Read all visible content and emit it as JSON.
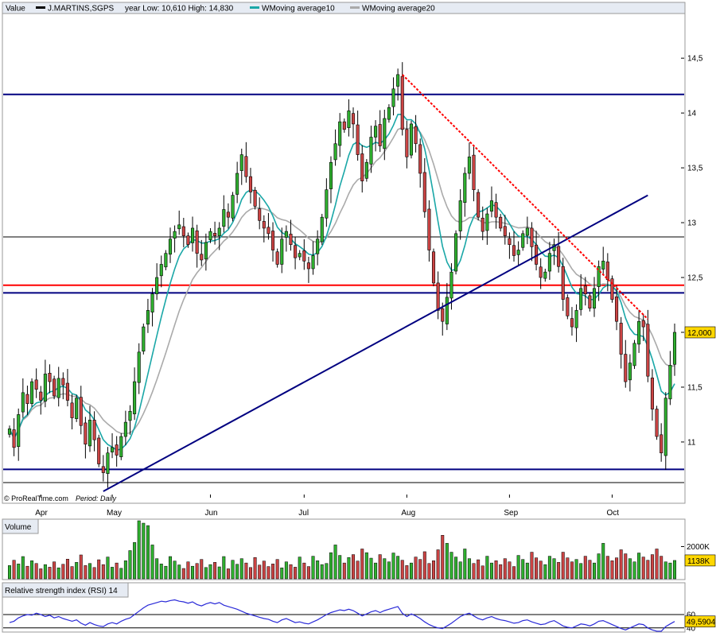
{
  "chart_data": [
    {
      "type": "candlestick",
      "header": {
        "label": "Value",
        "symbol": "J.MARTINS,SGPS",
        "range_text": "year Low: 10,610  High: 14,830",
        "ma10_label": "WMoving average10",
        "ma20_label": "WMoving average20"
      },
      "colors": {
        "up": "#2fb02f",
        "down": "#cc4444",
        "ma10": "#1aa7a7",
        "ma20": "#aaaaaa",
        "hline_blue": "#000080",
        "hline_red": "#ff0000",
        "trend": "#000080",
        "resistance": "#ff0000"
      },
      "ylim": [
        10.55,
        14.9
      ],
      "yticks": [
        11,
        11.5,
        12,
        12.5,
        13,
        13.5,
        14,
        14.5
      ],
      "ytick_labels": [
        "11",
        "11,5",
        "12",
        "12,5",
        "13",
        "13,5",
        "14",
        "14,5"
      ],
      "months": [
        {
          "label": "Apr",
          "day": 7
        },
        {
          "label": "May",
          "day": 23
        },
        {
          "label": "Jun",
          "day": 45
        },
        {
          "label": "Jul",
          "day": 66
        },
        {
          "label": "Aug",
          "day": 89
        },
        {
          "label": "Sep",
          "day": 112
        },
        {
          "label": "Oct",
          "day": 135
        }
      ],
      "current_price_label": "12,000",
      "current_price": 12.0,
      "hlines": [
        {
          "y": 14.17,
          "color": "#000080",
          "width": 2
        },
        {
          "y": 12.87,
          "color": "#000000",
          "width": 1
        },
        {
          "y": 12.43,
          "color": "#ff0000",
          "width": 2
        },
        {
          "y": 12.36,
          "color": "#000080",
          "width": 2
        },
        {
          "y": 10.75,
          "color": "#000080",
          "width": 2
        },
        {
          "y": 10.63,
          "color": "#000000",
          "width": 1
        }
      ],
      "trendline": {
        "x1": 21,
        "y1": 10.55,
        "x2": 143,
        "y2": 13.25
      },
      "resistance": {
        "x1": 88,
        "y1": 14.35,
        "x2": 143,
        "y2": 12.12
      },
      "footer_source": "© ProRealTime.com",
      "footer_period": "Period: Daily",
      "closes": [
        11.12,
        10.95,
        11.25,
        11.45,
        11.35,
        11.55,
        11.48,
        11.38,
        11.62,
        11.55,
        11.42,
        11.58,
        11.52,
        11.38,
        11.22,
        11.4,
        11.15,
        10.98,
        11.2,
        11.02,
        10.8,
        10.72,
        10.9,
        10.95,
        10.88,
        11.05,
        11.18,
        11.28,
        11.55,
        11.82,
        12.05,
        12.2,
        12.35,
        12.5,
        12.62,
        12.72,
        12.85,
        12.92,
        12.98,
        12.88,
        12.8,
        12.95,
        12.72,
        12.66,
        12.82,
        12.92,
        12.88,
        12.95,
        13.12,
        13.05,
        13.25,
        13.45,
        13.62,
        13.42,
        13.28,
        13.15,
        13.02,
        12.95,
        12.9,
        12.75,
        12.62,
        12.85,
        12.92,
        12.8,
        12.68,
        12.72,
        12.65,
        12.58,
        12.7,
        12.85,
        13.05,
        13.3,
        13.55,
        13.72,
        13.92,
        13.85,
        14.02,
        13.9,
        13.62,
        13.38,
        13.55,
        13.78,
        13.88,
        13.7,
        13.95,
        14.05,
        14.22,
        14.35,
        13.85,
        13.6,
        13.9,
        13.72,
        13.45,
        13.1,
        12.75,
        12.45,
        12.2,
        12.1,
        12.32,
        12.55,
        12.9,
        13.2,
        13.45,
        13.6,
        13.3,
        13.05,
        12.92,
        13.08,
        13.2,
        13.05,
        12.95,
        12.88,
        12.8,
        12.7,
        12.75,
        12.9,
        12.95,
        12.78,
        12.62,
        12.5,
        12.55,
        12.72,
        12.8,
        12.6,
        12.3,
        12.15,
        12.05,
        12.2,
        12.4,
        12.35,
        12.22,
        12.4,
        12.6,
        12.65,
        12.48,
        12.3,
        12.1,
        11.8,
        11.55,
        11.72,
        11.9,
        12.1,
        12.05,
        11.6,
        11.3,
        11.05,
        10.9,
        11.4,
        11.7,
        12.0
      ],
      "volume": {
        "label": "Volume",
        "ylim": [
          0,
          3600
        ],
        "yticks": [
          2000
        ],
        "ytick_labels": [
          "2000K"
        ],
        "current_label": "1138K",
        "current": 1138,
        "values": [
          820,
          1150,
          920,
          1380,
          780,
          1120,
          950,
          620,
          880,
          720,
          1050,
          680,
          900,
          1220,
          760,
          1020,
          1480,
          820,
          950,
          700,
          1180,
          880,
          1350,
          720,
          980,
          650,
          1120,
          1750,
          2250,
          3600,
          3450,
          3300,
          2100,
          1250,
          920,
          780,
          1380,
          1100,
          860,
          640,
          1050,
          780,
          950,
          1200,
          700,
          880,
          1020,
          740,
          1380,
          620,
          1150,
          900,
          1250,
          980,
          700,
          1320,
          850,
          1100,
          760,
          920,
          1200,
          680,
          1050,
          880,
          720,
          1350,
          980,
          760,
          1400,
          1120,
          880,
          950,
          1620,
          2100,
          1450,
          980,
          1320,
          1500,
          1100,
          1850,
          1620,
          1280,
          980,
          1500,
          1250,
          1050,
          1600,
          1400,
          1150,
          820,
          980,
          1350,
          1200,
          1680,
          950,
          1120,
          1800,
          2700,
          2200,
          1650,
          1350,
          1050,
          1850,
          1250,
          950,
          1180,
          800,
          1400,
          980,
          1120,
          880,
          1250,
          1050,
          760,
          1450,
          1200,
          980,
          1650,
          1300,
          1100,
          880,
          1400,
          1250,
          1020,
          1650,
          1300,
          1050,
          1200,
          950,
          1400,
          1150,
          980,
          1550,
          2200,
          1400,
          1120,
          1300,
          1800,
          1550,
          1250,
          1050,
          1600,
          1350,
          1150,
          1500,
          1850,
          1400,
          1050,
          980,
          1138
        ]
      },
      "rsi": {
        "label": "Relative strength index (RSI) 14",
        "ylim": [
          35,
          85
        ],
        "yticks": [
          40,
          60
        ],
        "ytick_labels": [
          "40",
          "60"
        ],
        "current_label": "49,5904",
        "current": 49.59,
        "values": [
          48,
          50,
          55,
          58,
          60,
          59,
          62,
          60,
          57,
          59,
          55,
          57,
          54,
          52,
          50,
          52,
          47,
          44,
          48,
          45,
          43,
          42,
          46,
          48,
          46,
          50,
          53,
          55,
          60,
          65,
          70,
          74,
          76,
          78,
          80,
          79,
          81,
          82,
          80,
          79,
          77,
          79,
          75,
          73,
          76,
          78,
          76,
          78,
          74,
          72,
          70,
          68,
          65,
          62,
          60,
          58,
          56,
          54,
          53,
          50,
          48,
          52,
          54,
          51,
          48,
          49,
          47,
          46,
          49,
          52,
          56,
          60,
          63,
          65,
          67,
          66,
          68,
          66,
          62,
          58,
          61,
          64,
          66,
          63,
          66,
          68,
          70,
          72,
          62,
          57,
          61,
          58,
          54,
          49,
          45,
          42,
          40,
          39,
          43,
          47,
          52,
          57,
          60,
          62,
          58,
          54,
          52,
          55,
          57,
          54,
          52,
          51,
          49,
          47,
          48,
          51,
          52,
          49,
          47,
          45,
          46,
          49,
          51,
          47,
          43,
          41,
          40,
          43,
          46,
          45,
          43,
          46,
          50,
          51,
          48,
          45,
          42,
          39,
          37,
          40,
          43,
          46,
          45,
          40,
          37,
          35,
          35,
          42,
          46,
          49.59
        ]
      }
    }
  ]
}
